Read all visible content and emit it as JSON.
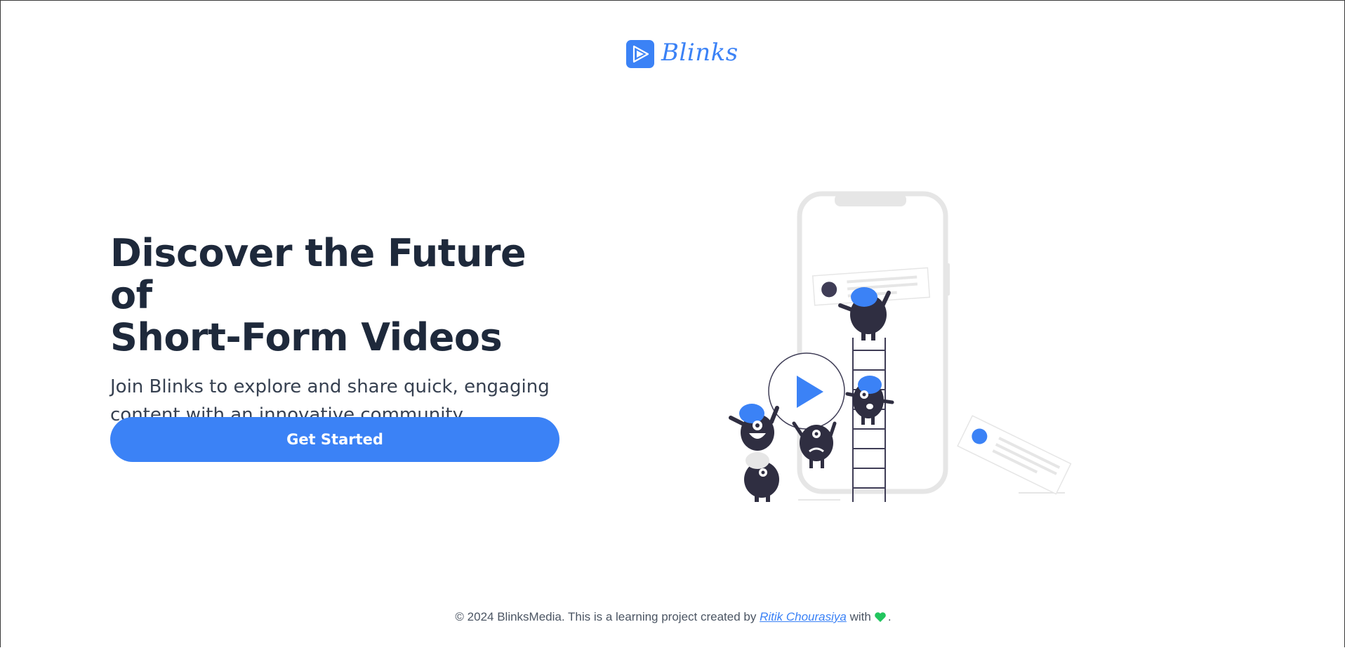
{
  "brand": {
    "name": "Blinks",
    "accent_color": "#3b82f6",
    "logo_icon": "play-icon"
  },
  "hero": {
    "title_line1": "Discover the Future of",
    "title_line2": "Short-Form Videos",
    "subtitle_line1": "Join Blinks to explore and share quick, engaging",
    "subtitle_line2": "content with an innovative community.",
    "cta_label": "Get Started"
  },
  "illustration": {
    "icon": "play-icon"
  },
  "footer": {
    "prefix": "© 2024 BlinksMedia. This is a learning project created by",
    "author_link": "Ritik Chourasiya",
    "with_text": "with",
    "heart_icon": "heart-icon",
    "heart_color": "#22c55e",
    "suffix": "."
  }
}
